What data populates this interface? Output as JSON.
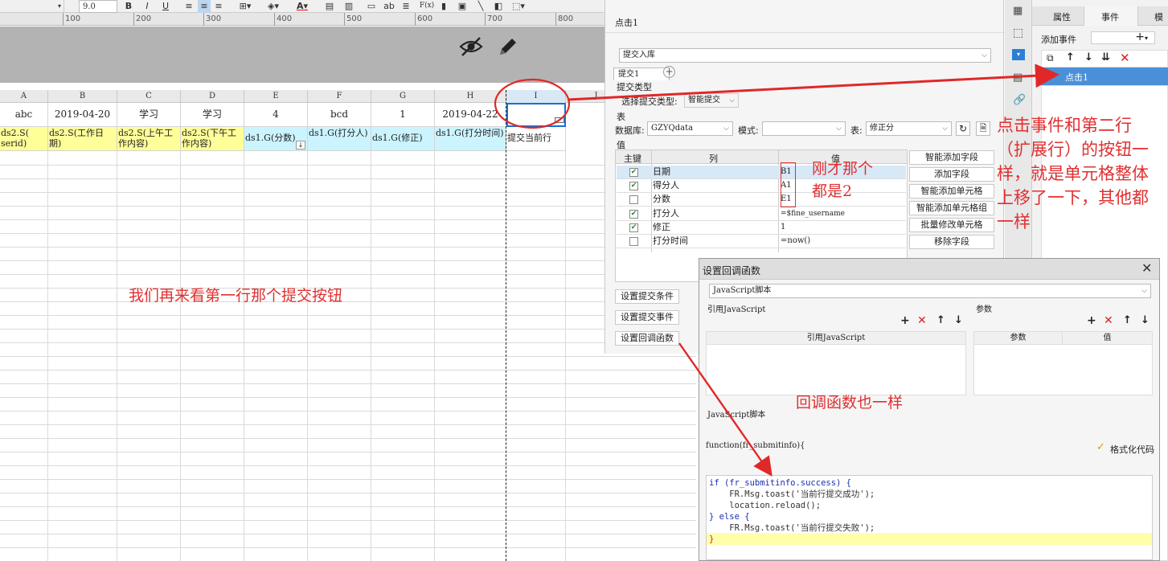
{
  "toolbar": {
    "font_size": "9.0",
    "bold": "B",
    "italic": "I",
    "underline": "U",
    "abc": "ab",
    "fx": "F(x)"
  },
  "ruler": {
    "ticks": [
      "100",
      "200",
      "300",
      "400",
      "500",
      "600",
      "700",
      "800"
    ]
  },
  "sheet": {
    "columns": [
      "A",
      "B",
      "C",
      "D",
      "E",
      "F",
      "G",
      "H",
      "I",
      "J"
    ],
    "row1": [
      "abc",
      "2019-04-20",
      "学习",
      "学习",
      "4",
      "bcd",
      "1",
      "2019-04-22",
      ""
    ],
    "row2": [
      "ds2.S(\nserid)",
      "ds2.S(工作日期)",
      "ds2.S(上午工作内容)",
      "ds2.S(下午工作内容)",
      "ds1.G(分数)",
      "ds1.G(打分人)",
      "ds1.G(修正)",
      "ds1.G(打分时间)",
      "提交当前行"
    ]
  },
  "panel": {
    "title": "点击1",
    "action_select": "提交入库",
    "tab": "提交1",
    "submit_type_label": "提交类型",
    "choose_type_label": "选择提交类型:",
    "choose_type_value": "智能提交",
    "table_label": "表",
    "db_label": "数据库:",
    "db_value": "GZYQdata",
    "mode_label": "模式:",
    "table_name_label": "表:",
    "table_name_value": "修正分",
    "value_label": "值",
    "grid_headers": [
      "主键",
      "列",
      "值"
    ],
    "grid_rows": [
      {
        "col": "日期",
        "val": "B1",
        "checked": true
      },
      {
        "col": "得分人",
        "val": "A1",
        "checked": true
      },
      {
        "col": "分数",
        "val": "E1",
        "checked": false
      },
      {
        "col": "打分人",
        "val": "=$fine_username",
        "checked": true
      },
      {
        "col": "修正",
        "val": "1",
        "checked": true
      },
      {
        "col": "打分时间",
        "val": "=now()",
        "checked": false
      }
    ],
    "side_buttons": [
      "智能添加字段",
      "添加字段",
      "智能添加单元格",
      "智能添加单元格组",
      "批量修改单元格",
      "移除字段"
    ],
    "bottom_buttons": [
      "设置提交条件",
      "设置提交事件",
      "设置回调函数"
    ]
  },
  "farright": {
    "tabs": [
      "属性",
      "事件",
      "模"
    ],
    "add_event_label": "添加事件",
    "event_item": "点击1"
  },
  "dialog": {
    "title": "设置回调函数",
    "script_select": "JavaScript脚本",
    "ref_js_label": "引用JavaScript",
    "params_label": "参数",
    "ref_js_col": "引用JavaScript",
    "param_cols": [
      "参数",
      "值"
    ],
    "js_label": "JavaScript脚本",
    "func_sig": "function(fr_submitinfo){",
    "format_btn": "格式化代码",
    "code": [
      {
        "t": "if (fr_submitinfo.success) {",
        "hl": false
      },
      {
        "t": "    FR.Msg.toast('当前行提交成功');",
        "hl": false
      },
      {
        "t": "    location.reload();",
        "hl": false
      },
      {
        "t": "} else {",
        "hl": false
      },
      {
        "t": "    FR.Msg.toast('当前行提交失败');",
        "hl": false
      },
      {
        "t": "}",
        "hl": true
      }
    ]
  },
  "annotations": {
    "note_sheet": "我们再来看第一行那个提交按钮",
    "note_values": "刚才那个\n都是2",
    "note_right": "点击事件和第二行\n（扩展行）的按钮一\n样，就是单元格整体\n上移了一下，其他都\n一样",
    "note_callback": "回调函数也一样"
  },
  "colors": {
    "annotation": "#e03030",
    "yellow": "#ffff99",
    "cyan": "#ccf4ff",
    "selected": "#4a90d9"
  }
}
